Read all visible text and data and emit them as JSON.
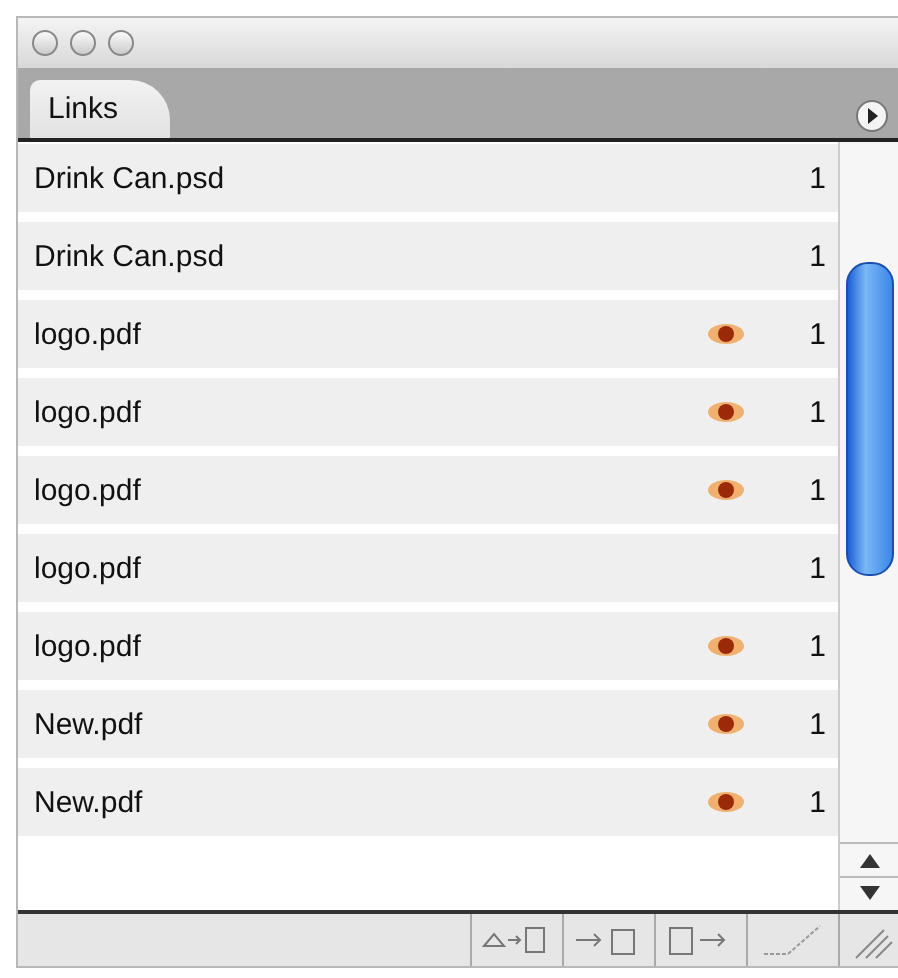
{
  "panel": {
    "tab": "Links"
  },
  "links": [
    {
      "name": "Drink Can.psd",
      "modified": false,
      "count": "1"
    },
    {
      "name": "Drink Can.psd",
      "modified": false,
      "count": "1"
    },
    {
      "name": "logo.pdf",
      "modified": true,
      "count": "1"
    },
    {
      "name": "logo.pdf",
      "modified": true,
      "count": "1"
    },
    {
      "name": "logo.pdf",
      "modified": true,
      "count": "1"
    },
    {
      "name": "logo.pdf",
      "modified": false,
      "count": "1"
    },
    {
      "name": "logo.pdf",
      "modified": true,
      "count": "1"
    },
    {
      "name": "New.pdf",
      "modified": true,
      "count": "1"
    },
    {
      "name": "New.pdf",
      "modified": true,
      "count": "1"
    }
  ]
}
